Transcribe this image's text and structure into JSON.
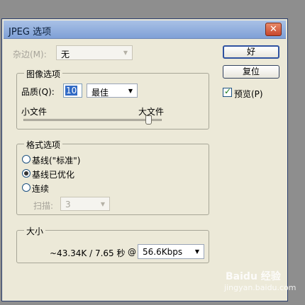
{
  "dialog": {
    "title": "JPEG 选项",
    "close_icon": "close-icon"
  },
  "matte": {
    "label": "杂边(M):",
    "value": "无"
  },
  "image_options": {
    "legend": "图像选项",
    "quality_label": "品质(Q):",
    "quality_value": "10",
    "quality_preset": "最佳",
    "small_file": "小文件",
    "large_file": "大文件",
    "slider_level": 0.9
  },
  "format_options": {
    "legend": "格式选项",
    "options": [
      "基线(\"标准\")",
      "基线已优化",
      "连续"
    ],
    "selected_index": 1,
    "scans_label": "扫描:",
    "scans_value": "3"
  },
  "size": {
    "legend": "大小",
    "info": "~43.34K / 7.65 秒",
    "at": "@",
    "speed": "56.6Kbps"
  },
  "buttons": {
    "ok": "好",
    "reset": "复位"
  },
  "preview": {
    "label": "预览(P)",
    "checked": true
  },
  "watermark": {
    "text": "Baidu 经验",
    "url": "jingyan.baidu.com"
  }
}
